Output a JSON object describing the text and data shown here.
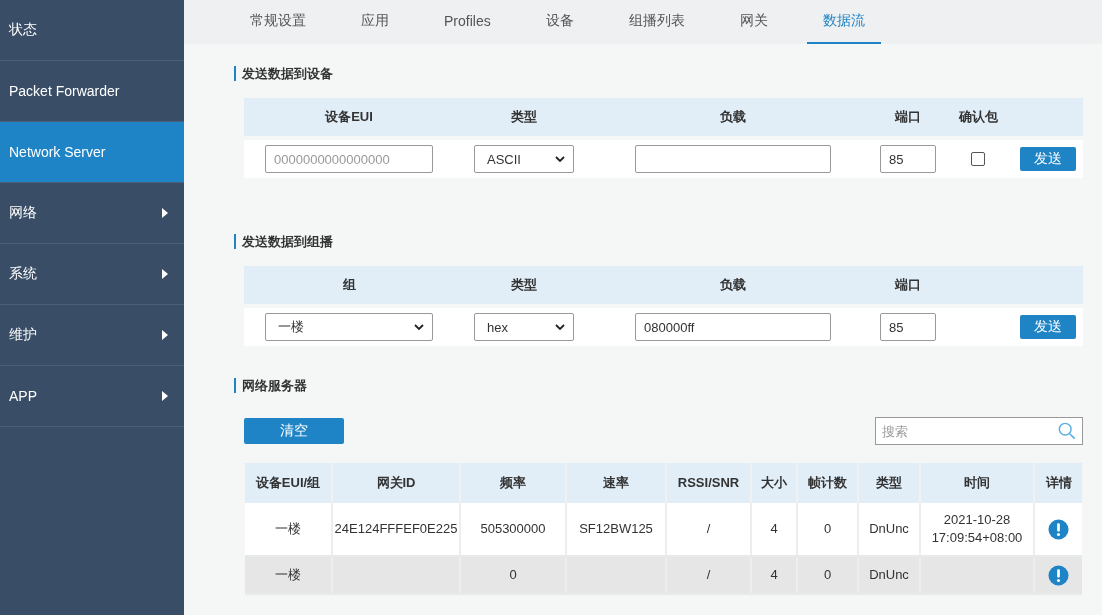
{
  "sidebar": {
    "items": [
      {
        "label": "状态",
        "selected": false,
        "has_submenu": false
      },
      {
        "label": "Packet Forwarder",
        "selected": false,
        "has_submenu": false
      },
      {
        "label": "Network Server",
        "selected": true,
        "has_submenu": false
      },
      {
        "label": "网络",
        "selected": false,
        "has_submenu": true
      },
      {
        "label": "系统",
        "selected": false,
        "has_submenu": true
      },
      {
        "label": "维护",
        "selected": false,
        "has_submenu": true
      },
      {
        "label": "APP",
        "selected": false,
        "has_submenu": true
      }
    ]
  },
  "tabs": [
    {
      "label": "常规设置",
      "selected": false
    },
    {
      "label": "应用",
      "selected": false
    },
    {
      "label": "Profiles",
      "selected": false
    },
    {
      "label": "设备",
      "selected": false
    },
    {
      "label": "组播列表",
      "selected": false
    },
    {
      "label": "网关",
      "selected": false
    },
    {
      "label": "数据流",
      "selected": true
    }
  ],
  "send_to_device": {
    "title": "发送数据到设备",
    "columns": [
      "设备EUI",
      "类型",
      "负载",
      "端口",
      "确认包"
    ],
    "eui_placeholder": "0000000000000000",
    "type": "ASCII",
    "port": "85",
    "confirmed": false,
    "button": "发送"
  },
  "send_to_multicast": {
    "title": "发送数据到组播",
    "columns": [
      "组",
      "类型",
      "负载",
      "端口"
    ],
    "group": "一楼",
    "type": "hex",
    "payload": "080000ff",
    "port": "85",
    "button": "发送"
  },
  "network_server": {
    "title": "网络服务器",
    "clear_button": "清空",
    "search_placeholder": "搜索",
    "columns": [
      "设备EUI/组",
      "网关ID",
      "频率",
      "速率",
      "RSSI/SNR",
      "大小",
      "帧计数",
      "类型",
      "时间",
      "详情"
    ],
    "rows": [
      {
        "selected": false,
        "cells": [
          "一楼",
          "24E124FFFEF0E225",
          "505300000",
          "SF12BW125",
          "/",
          "4",
          "0",
          "DnUnc",
          "2021-10-28 17:09:54+08:00"
        ]
      },
      {
        "selected": true,
        "cells": [
          "一楼",
          "",
          "0",
          "",
          "/",
          "4",
          "0",
          "DnUnc",
          ""
        ]
      }
    ]
  }
}
